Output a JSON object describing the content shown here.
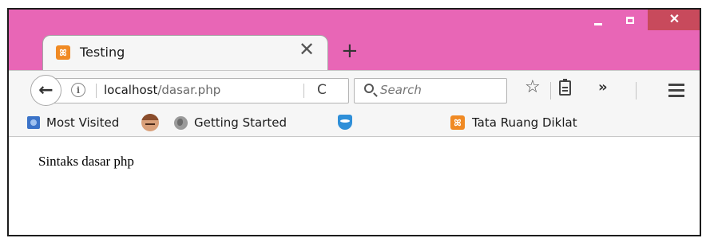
{
  "window": {
    "minimize_glyph": "",
    "maximize_glyph": "",
    "close_glyph": "✕"
  },
  "tab": {
    "title": "Testing",
    "favicon_glyph": "ꕤ",
    "close_glyph": "✕"
  },
  "new_tab_glyph": "+",
  "nav": {
    "back_glyph": "←",
    "info_glyph": "i",
    "url_host": "localhost",
    "url_path": "/dasar.php",
    "reload_glyph": "C",
    "search_placeholder": "Search",
    "bookmark_star_glyph": "☆",
    "overflow_glyph": "»"
  },
  "bookmarks": {
    "most_visited": "Most Visited",
    "getting_started": "Getting Started",
    "tata_ruang": "Tata Ruang Diklat",
    "xampp_glyph": "ꕤ"
  },
  "page": {
    "body_text": "Sintaks dasar php"
  },
  "colors": {
    "titlebar": "#e866b6",
    "close_button": "#c84a5c",
    "toolbar": "#f6f6f6",
    "xampp_orange": "#f08a24"
  },
  "icons": [
    "xampp-icon",
    "close-icon",
    "plus-icon",
    "back-arrow-icon",
    "info-icon",
    "reload-icon",
    "search-icon",
    "star-icon",
    "clipboard-icon",
    "overflow-icon",
    "hamburger-menu-icon",
    "most-visited-icon",
    "avatar-icon",
    "globe-icon",
    "shield-icon"
  ]
}
